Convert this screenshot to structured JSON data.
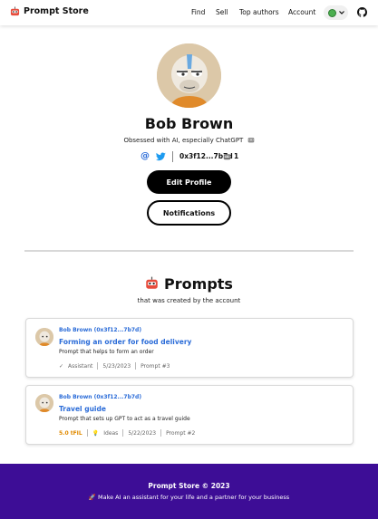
{
  "header": {
    "brand": "Prompt Store",
    "nav": [
      "Find",
      "Sell",
      "Top authors",
      "Account"
    ]
  },
  "profile": {
    "name": "Bob Brown",
    "bio": "Obsessed with AI, especially ChatGPT",
    "address": "0x3f12...7b7d",
    "robot_count": "1"
  },
  "buttons": {
    "edit": "Edit Profile",
    "notifications": "Notifications"
  },
  "prompts_section": {
    "title": "Prompts",
    "subtitle": "that was created by the account"
  },
  "prompts": [
    {
      "author": "Bob Brown (0x3f12...7b7d)",
      "title": "Forming an order for food delivery",
      "description": "Prompt that helps to form an order",
      "price": "",
      "category": "Assistant",
      "date": "5/23/2023",
      "number": "Prompt #3"
    },
    {
      "author": "Bob Brown (0x3f12...7b7d)",
      "title": "Travel guide",
      "description": "Prompt that sets up GPT to act as a travel guide",
      "price": "5.0 tFIL",
      "category": "Ideas",
      "date": "5/22/2023",
      "number": "Prompt #2"
    }
  ],
  "footer": {
    "title": "Prompt Store © 2023",
    "tagline": "Make AI an assistant for your life and a partner for your business"
  },
  "colors": {
    "accent_blue": "#2b6cd8",
    "footer_purple": "#3d0d96",
    "price_orange": "#e08a00",
    "status_green": "#4caf50"
  },
  "icons": [
    "robot-icon",
    "chevron-down-icon",
    "github-icon",
    "at-icon",
    "twitter-icon",
    "check-icon",
    "bulb-icon",
    "rocket-icon"
  ]
}
